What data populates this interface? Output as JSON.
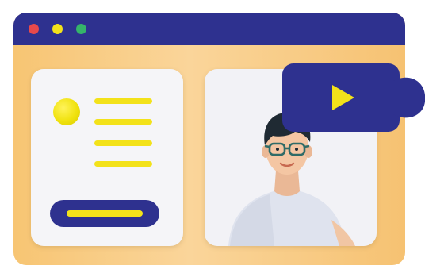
{
  "colors": {
    "window_bar": "#2e318f",
    "window_body": "#f8cd83",
    "traffic_red": "#e8494b",
    "traffic_yellow": "#f3e21a",
    "traffic_green": "#35b46a",
    "accent_yellow": "#f3e21a",
    "card_bg": "#f5f5f8",
    "camera_bg": "#2e318f"
  },
  "icons": {
    "play": "play-icon",
    "camera": "video-camera-icon"
  }
}
